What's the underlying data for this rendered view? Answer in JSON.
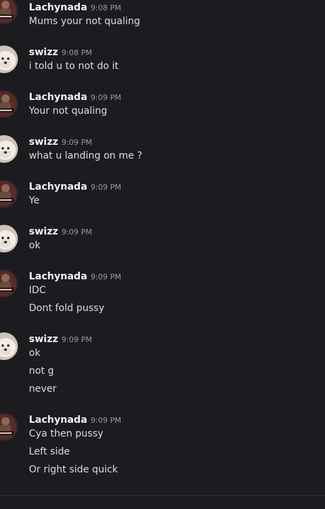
{
  "messages": [
    {
      "author": "Lachynada",
      "avatar": "lachynada-avatar",
      "time": "9:08 PM",
      "lines": [
        "Mums your not qualing"
      ]
    },
    {
      "author": "swizz",
      "avatar": "swizz-avatar",
      "time": "9:08 PM",
      "lines": [
        "i told u to not do it"
      ]
    },
    {
      "author": "Lachynada",
      "avatar": "lachynada-avatar",
      "time": "9:09 PM",
      "lines": [
        "Your not qualing"
      ]
    },
    {
      "author": "swizz",
      "avatar": "swizz-avatar",
      "time": "9:09 PM",
      "lines": [
        "what u landing on me ?"
      ]
    },
    {
      "author": "Lachynada",
      "avatar": "lachynada-avatar",
      "time": "9:09 PM",
      "lines": [
        "Ye"
      ]
    },
    {
      "author": "swizz",
      "avatar": "swizz-avatar",
      "time": "9:09 PM",
      "lines": [
        "ok"
      ]
    },
    {
      "author": "Lachynada",
      "avatar": "lachynada-avatar",
      "time": "9:09 PM",
      "lines": [
        "IDC",
        "Dont fold pussy"
      ]
    },
    {
      "author": "swizz",
      "avatar": "swizz-avatar",
      "time": "9:09 PM",
      "lines": [
        "ok",
        "not g",
        "never"
      ]
    },
    {
      "author": "Lachynada",
      "avatar": "lachynada-avatar",
      "time": "9:09 PM",
      "lines": [
        "Cya then pussy",
        "Left side",
        "Or right side quick"
      ]
    }
  ],
  "colors": {
    "background": "#1c1c20",
    "author": "#f2f3f5",
    "timestamp": "#949ba4",
    "message_text": "#dbdee1"
  }
}
